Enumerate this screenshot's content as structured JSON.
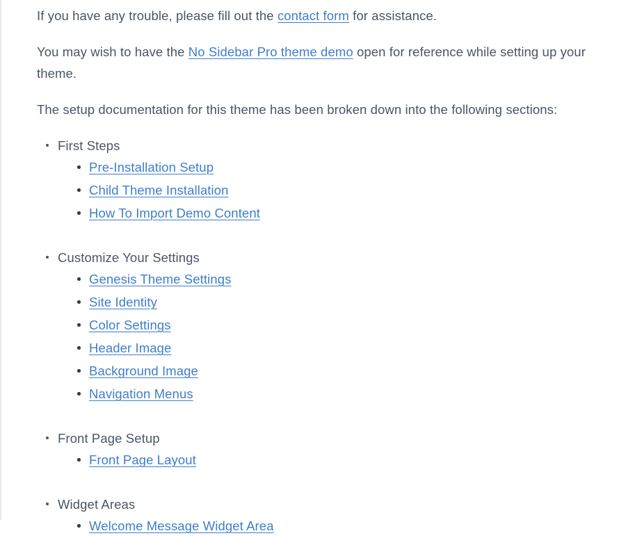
{
  "document": {
    "paragraphs": [
      {
        "id": "trouble",
        "before": "If you have any trouble, please fill out the ",
        "link": "contact form",
        "after": " for assistance."
      },
      {
        "id": "demo-reference",
        "before": "You may wish to have the ",
        "link": "No Sidebar Pro theme demo",
        "after": " open for reference while setting up your theme."
      }
    ],
    "intro": "The setup documentation for this theme has been broken down into the following sections:",
    "sections": [
      {
        "label": "First Steps",
        "links": [
          "Pre-Installation Setup",
          "Child Theme Installation",
          "How To Import Demo Content"
        ]
      },
      {
        "label": "Customize Your Settings",
        "links": [
          "Genesis Theme Settings",
          "Site Identity",
          "Color Settings",
          "Header Image",
          "Background Image",
          "Navigation Menus"
        ]
      },
      {
        "label": "Front Page Setup",
        "links": [
          "Front Page Layout"
        ]
      },
      {
        "label": "Widget Areas",
        "links": [
          "Welcome Message Widget Area"
        ]
      }
    ]
  },
  "colors": {
    "body_text": "#4a5568",
    "link": "#3f7ecb",
    "background": "#ffffff",
    "left_rule": "#e6e6ef"
  }
}
